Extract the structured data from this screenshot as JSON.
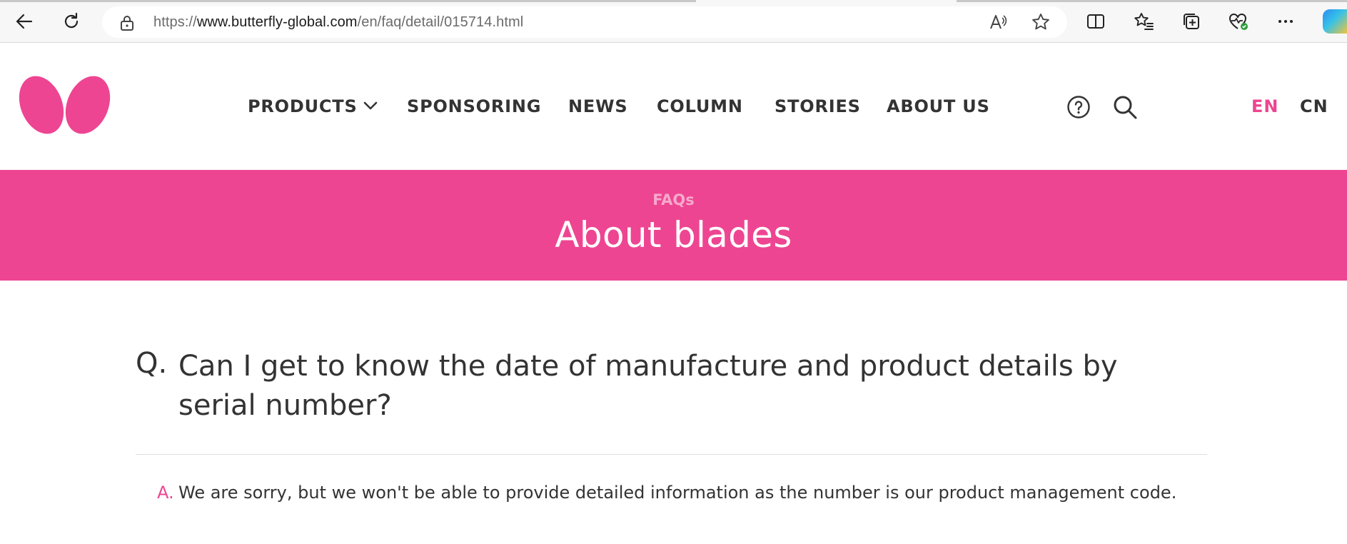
{
  "browser": {
    "url_scheme": "https://",
    "url_host": "www.butterfly-global.com",
    "url_path": "/en/faq/detail/015714.html"
  },
  "site": {
    "brand_color": "#ee4592",
    "logo_icon": "butterfly-logo-icon",
    "nav": {
      "products": "PRODUCTS",
      "sponsoring": "SPONSORING",
      "news": "NEWS",
      "column": "COLUMN",
      "stories": "STORIES",
      "about": "ABOUT US"
    },
    "languages": {
      "active": "EN",
      "other": "CN"
    }
  },
  "hero": {
    "eyebrow": "FAQs",
    "title": "About blades"
  },
  "faq": {
    "question_marker": "Q.",
    "question": "Can I get to know the date of manufacture and product details by serial number?",
    "answer_marker": "A.",
    "answer": "We are sorry, but we won't be able to provide detailed information as the number is our product management code."
  }
}
